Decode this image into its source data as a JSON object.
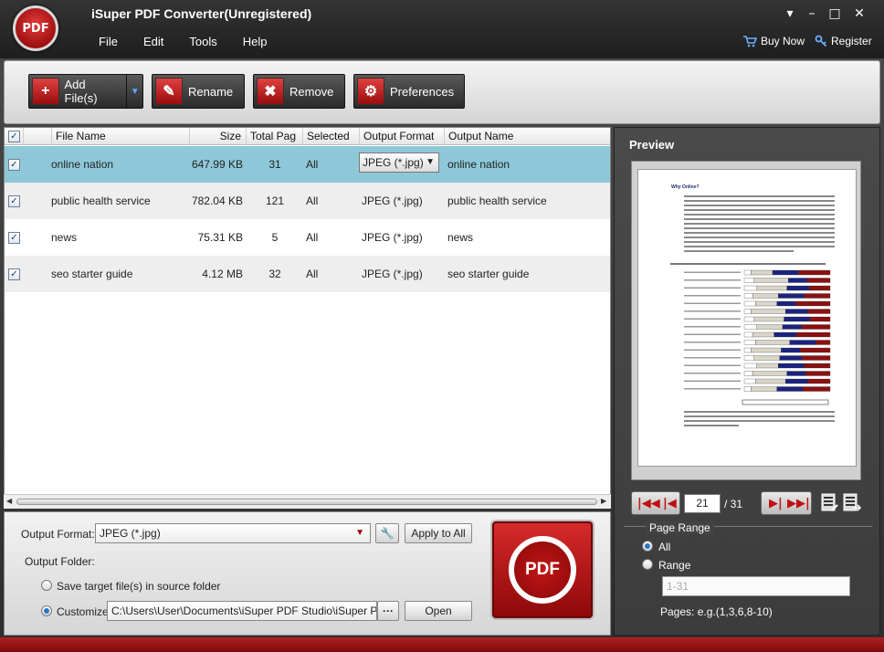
{
  "window": {
    "title": "iSuper PDF Converter(Unregistered)",
    "logo_text": "PDF",
    "controls": {
      "menu": "▾",
      "minimize": "–",
      "maximize": "□",
      "close": "✕"
    }
  },
  "menu": {
    "items": [
      "File",
      "Edit",
      "Tools",
      "Help"
    ],
    "buy_now": "Buy Now",
    "register": "Register"
  },
  "toolbar": {
    "add_files": "Add File(s)",
    "rename": "Rename",
    "remove": "Remove",
    "preferences": "Preferences"
  },
  "table": {
    "columns": [
      "File Name",
      "Size",
      "Total Pag",
      "Selected",
      "Output Format",
      "Output Name"
    ],
    "rows": [
      {
        "checked": true,
        "file_name": "online nation",
        "size": "647.99 KB",
        "total_pages": "31",
        "selected": "All",
        "output_format": "JPEG (*.jpg)",
        "output_name": "online nation"
      },
      {
        "checked": true,
        "file_name": "public health service",
        "size": "782.04 KB",
        "total_pages": "121",
        "selected": "All",
        "output_format": "JPEG (*.jpg)",
        "output_name": "public health service"
      },
      {
        "checked": true,
        "file_name": "news",
        "size": "75.31 KB",
        "total_pages": "5",
        "selected": "All",
        "output_format": "JPEG (*.jpg)",
        "output_name": "news"
      },
      {
        "checked": true,
        "file_name": "seo starter guide",
        "size": "4.12 MB",
        "total_pages": "32",
        "selected": "All",
        "output_format": "JPEG (*.jpg)",
        "output_name": "seo starter guide"
      }
    ]
  },
  "settings": {
    "output_format_label": "Output Format:",
    "output_format_value": "JPEG (*.jpg)",
    "apply_to_all": "Apply to All",
    "output_folder_label": "Output Folder:",
    "save_source_label": "Save target file(s) in source folder",
    "customize_label": "Customize:",
    "customize_path": "C:\\Users\\User\\Documents\\iSuper PDF Studio\\iSuper PDF Con",
    "browse": "···",
    "open": "Open",
    "convert_text": "PDF"
  },
  "preview": {
    "title": "Preview",
    "doc_heading": "Why Online?",
    "current_page": "21",
    "total_pages": "/ 31",
    "page_range_label": "Page Range",
    "all_label": "All",
    "range_label": "Range",
    "range_placeholder": "1-31",
    "pages_hint": "Pages: e.g.(1,3,6,8-10)"
  },
  "colors": {
    "accent_red": "#c01010",
    "selected_row": "#8ec8d8"
  }
}
